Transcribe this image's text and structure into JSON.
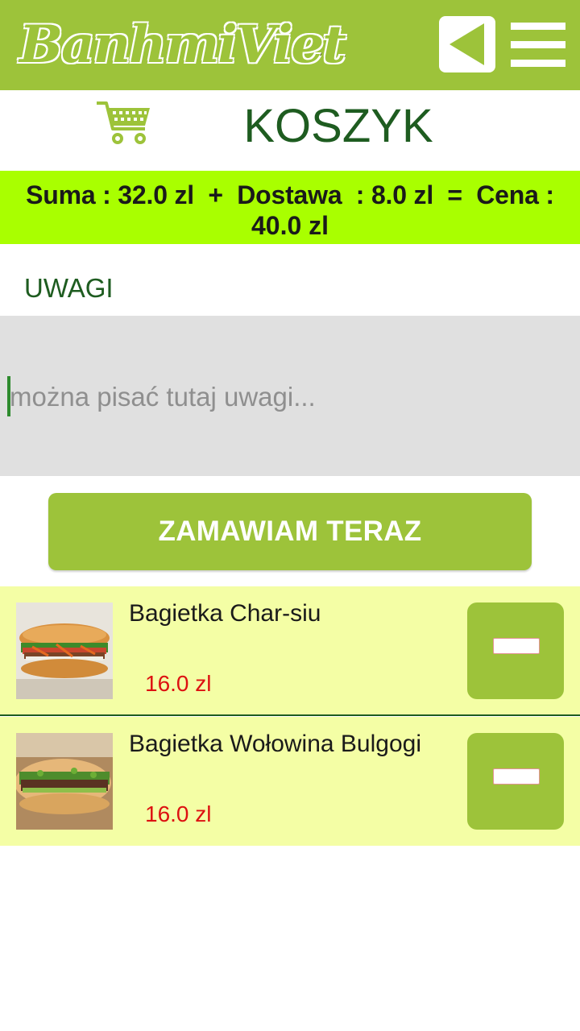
{
  "app": {
    "logo_text": "BanhmiViet",
    "brand_color": "#9dc33a",
    "back_icon": "back-triangle-icon",
    "menu_icon": "hamburger-menu-icon"
  },
  "page": {
    "title": "KOSZYK",
    "cart_icon": "shopping-cart-icon"
  },
  "summary": {
    "line1": "Suma : 32.0 zl  +  Dostawa  : 8.0 zl  =  Cena :",
    "line2": "40.0 zl"
  },
  "notes": {
    "label": "UWAGI",
    "placeholder": "można pisać tutaj uwagi...",
    "value": ""
  },
  "order_button": {
    "label": "ZAMAWIAM TERAZ"
  },
  "cart_items": [
    {
      "name": "Bagietka Char-siu",
      "price": "16.0 zl",
      "remove_icon": "minus-icon"
    },
    {
      "name": "Bagietka Wołowina Bulgogi",
      "price": "16.0 zl",
      "remove_icon": "minus-icon"
    }
  ]
}
